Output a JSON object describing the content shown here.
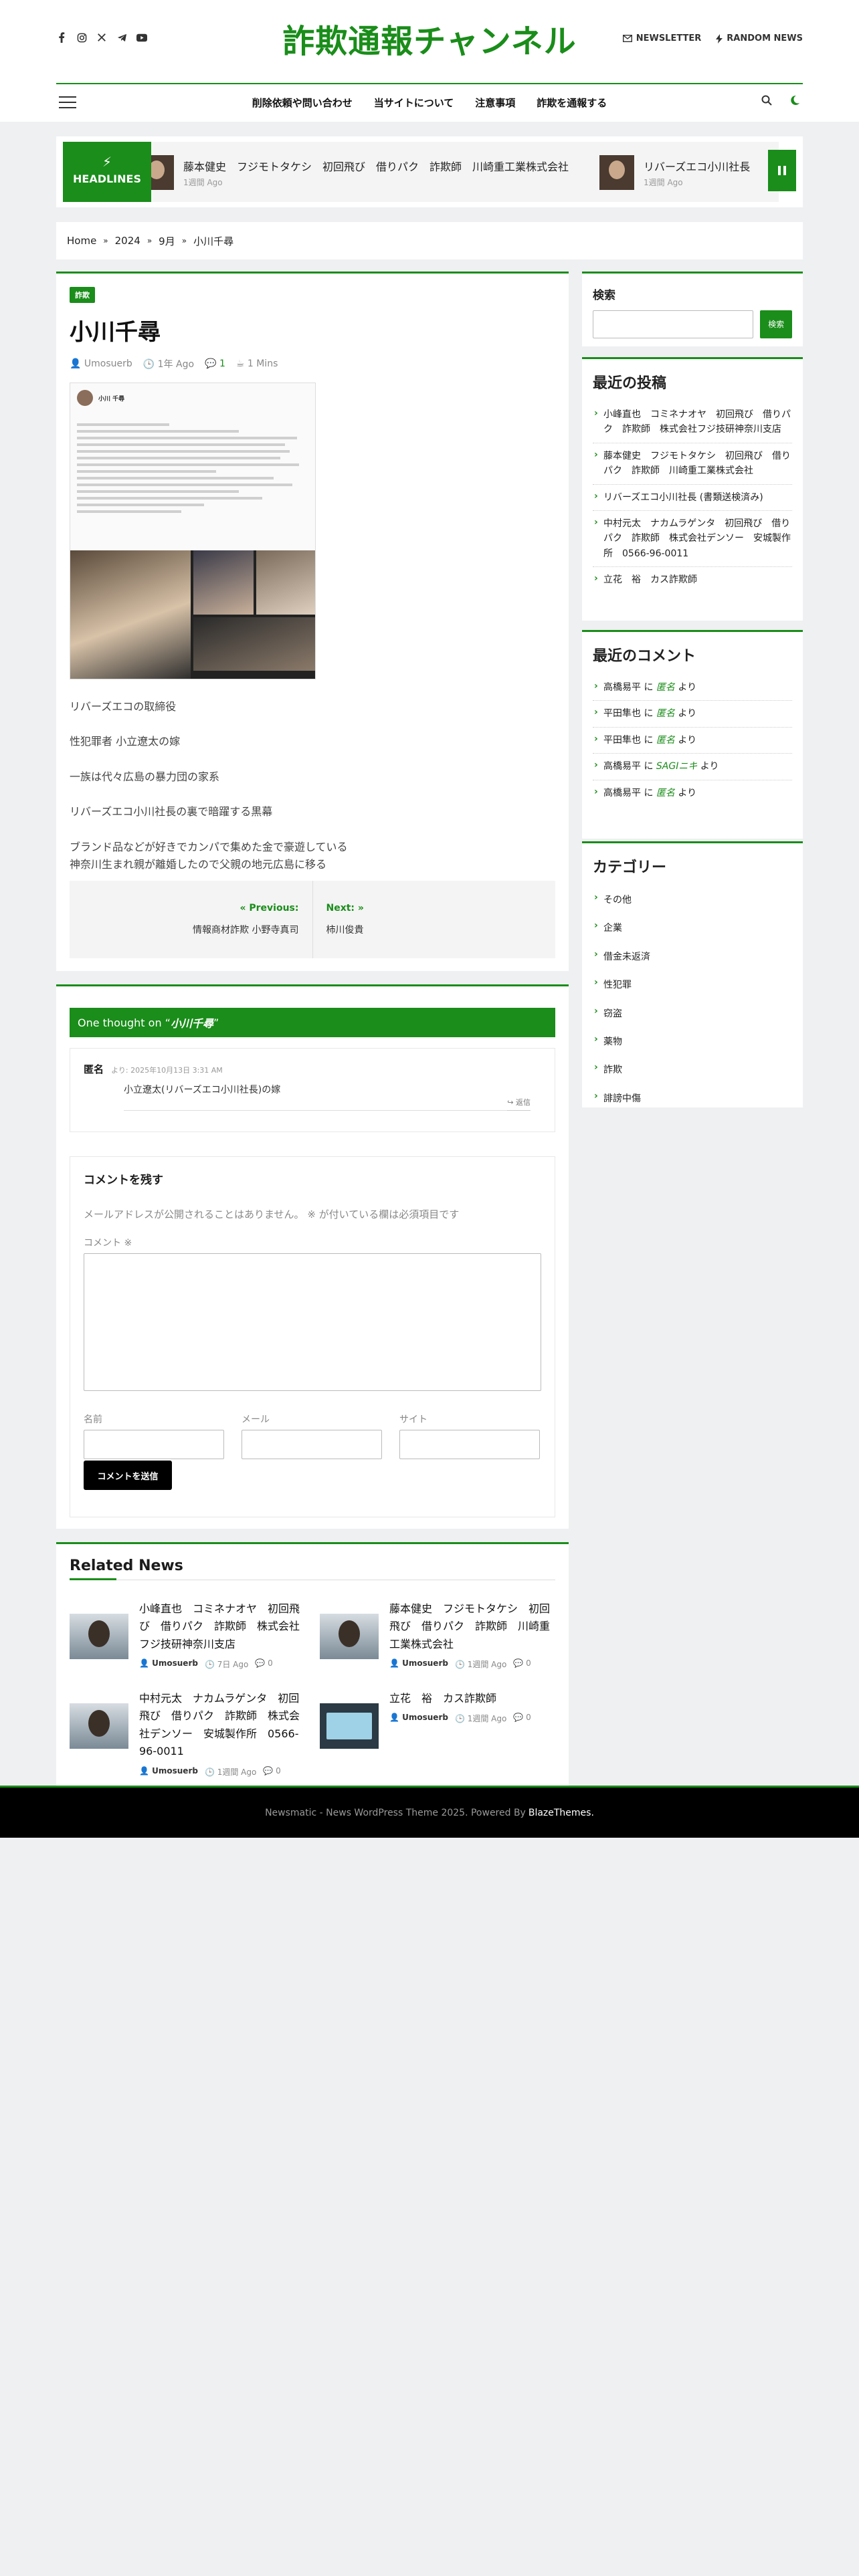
{
  "header": {
    "brand": "詐欺通報チャンネル",
    "links": [
      "NEWSLETTER",
      "RANDOM NEWS"
    ],
    "social": [
      "facebook-icon",
      "instagram-icon",
      "x-icon",
      "telegram-icon",
      "youtube-icon"
    ]
  },
  "nav": {
    "menu": [
      "削除依頼や問い合わせ",
      "当サイトについて",
      "注意事項",
      "詐欺を通報する"
    ]
  },
  "headlines": {
    "label": "HEADLINES",
    "items": [
      {
        "title": "藤本健史　フジモトタケシ　初回飛び　借りパク　詐欺師　川崎重工業株式会社",
        "date": "1週間 Ago"
      },
      {
        "title": "リバーズエコ小川社長",
        "date": "1週間 Ago"
      }
    ]
  },
  "breadcrumb": [
    "Home",
    "2024",
    "9月",
    "小川千尋"
  ],
  "post": {
    "category": "詐欺",
    "title": "小川千尋",
    "author": "Umosuerb",
    "date": "1年 Ago",
    "comments": "1",
    "read": "1 Mins",
    "image_caption_name": "小川 千尋",
    "paragraphs": [
      "リバーズエコの取締役",
      "性犯罪者 小立遼太の嫁",
      "一族は代々広島の暴力団の家系",
      "リバーズエコ小川社長の裏で暗躍する黒幕",
      "ブランド品などが好きでカンパで集めた金で豪遊している\n神奈川生まれ親が離婚したので父親の地元広島に移る"
    ],
    "prev_label": "Previous:",
    "prev_title": "情報商材詐欺 小野寺真司",
    "next_label": "Next:",
    "next_title": "柿川俊貴"
  },
  "comments": {
    "title_prefix": "One thought on “",
    "title_post": "小川千尋",
    "title_suffix": "”",
    "items": [
      {
        "author": "匿名",
        "date": "より: 2025年10月13日 3:31 AM",
        "text": "小立遼太(リバーズエコ小川社長)の嫁",
        "reply": "返信"
      }
    ],
    "form": {
      "title": "コメントを残す",
      "note": "メールアドレスが公開されることはありません。 ※ が付いている欄は必須項目です",
      "comment_label": "コメント ※",
      "name_label": "名前",
      "email_label": "メール",
      "site_label": "サイト",
      "submit": "コメントを送信"
    }
  },
  "related": {
    "title": "Related News",
    "items": [
      {
        "title": "小峰直也　コミネナオヤ　初回飛び　借りパク　詐欺師　株式会社フジ技研神奈川支店",
        "author": "Umosuerb",
        "date": "7日 Ago",
        "comments": "0"
      },
      {
        "title": "藤本健史　フジモトタケシ　初回飛び　借りパク　詐欺師　川崎重工業株式会社",
        "author": "Umosuerb",
        "date": "1週間 Ago",
        "comments": "0"
      },
      {
        "title": "中村元太　ナカムラゲンタ　初回飛び　借りパク　詐欺師　株式会社デンソー　安城製作所　0566-96-0011",
        "author": "Umosuerb",
        "date": "1週間 Ago",
        "comments": "0"
      },
      {
        "title": "立花　裕　カス詐欺師",
        "author": "Umosuerb",
        "date": "1週間 Ago",
        "comments": "0"
      }
    ]
  },
  "sidebar": {
    "search_title": "検索",
    "search_button": "検索",
    "recent_title": "最近の投稿",
    "recent": [
      "小峰直也　コミネナオヤ　初回飛び　借りパク　詐欺師　株式会社フジ技研神奈川支店",
      "藤本健史　フジモトタケシ　初回飛び　借りパク　詐欺師　川崎重工業株式会社",
      "リバーズエコ小川社長 (書類送検済み)",
      "中村元太　ナカムラゲンタ　初回飛び　借りパク　詐欺師　株式会社デンソー　安城製作所　0566-96-0011",
      "立花　裕　カス詐欺師"
    ],
    "comments_title": "最近のコメント",
    "recent_comments": [
      {
        "who": "高橋易平",
        "mid": " に ",
        "on": "匿名",
        "end": " より"
      },
      {
        "who": "平田隼也",
        "mid": " に ",
        "on": "匿名",
        "end": " より"
      },
      {
        "who": "平田隼也",
        "mid": " に ",
        "on": "匿名",
        "end": " より"
      },
      {
        "who": "高橋易平",
        "mid": " に ",
        "on": "SAGIニキ",
        "end": " より"
      },
      {
        "who": "高橋易平",
        "mid": " に ",
        "on": "匿名",
        "end": " より"
      }
    ],
    "cat_title": "カテゴリー",
    "categories": [
      "その他",
      "企業",
      "借金未返済",
      "性犯罪",
      "窃盗",
      "薬物",
      "詐欺",
      "誹謗中傷"
    ]
  },
  "footer": {
    "text": "Newsmatic - News WordPress Theme 2025. Powered By",
    "theme": "BlazeThemes."
  },
  "colors": {
    "accent": "#1a8d1a",
    "footer": "#000000"
  }
}
